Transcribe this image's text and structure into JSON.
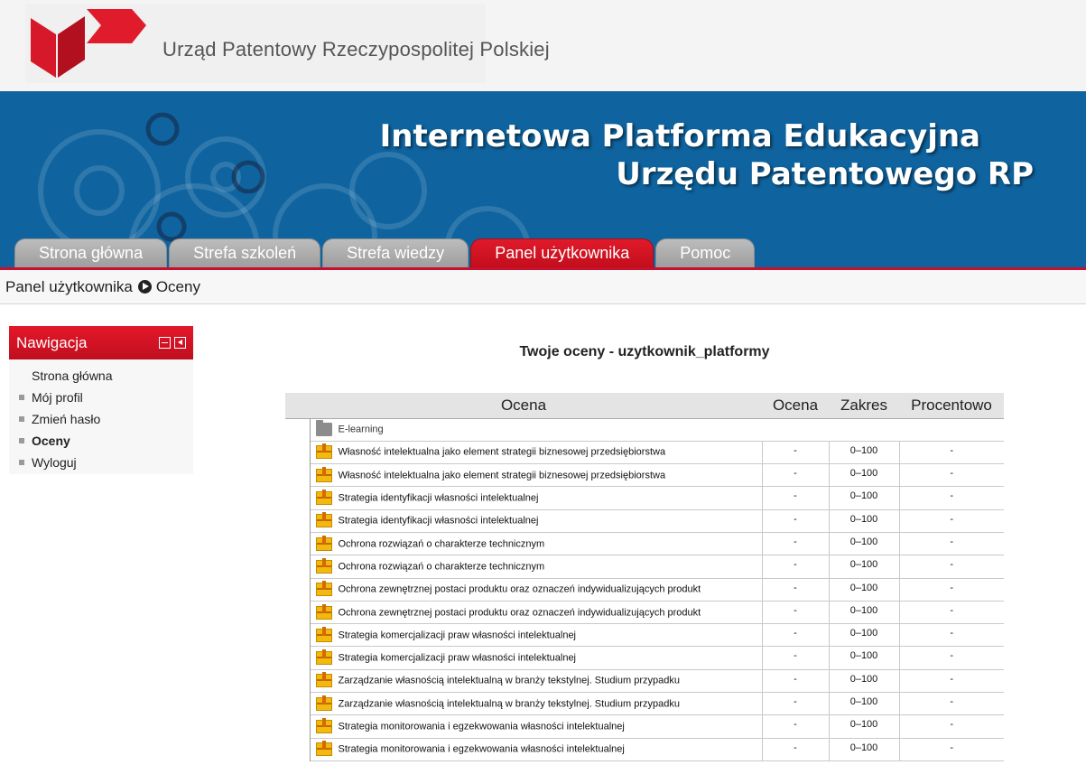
{
  "org": {
    "name": "Urząd Patentowy Rzeczypospolitej Polskiej",
    "brand_color": "#d6182a"
  },
  "banner": {
    "title_line1": "Internetowa Platforma Edukacyjna",
    "title_line2": "Urzędu Patentowego RP",
    "background_color": "#0f64a0"
  },
  "tabs": [
    {
      "label": "Strona główna",
      "active": false
    },
    {
      "label": "Strefa szkoleń",
      "active": false
    },
    {
      "label": "Strefa wiedzy",
      "active": false
    },
    {
      "label": "Panel użytkownika",
      "active": true
    },
    {
      "label": "Pomoc",
      "active": false
    }
  ],
  "breadcrumb": {
    "items": [
      "Panel użytkownika",
      "Oceny"
    ]
  },
  "navigation": {
    "title": "Nawigacja",
    "items": [
      {
        "label": "Strona główna",
        "bullet": false,
        "bold": false
      },
      {
        "label": "Mój profil",
        "bullet": true,
        "bold": false
      },
      {
        "label": "Zmień hasło",
        "bullet": true,
        "bold": false
      },
      {
        "label": "Oceny",
        "bullet": true,
        "bold": true
      },
      {
        "label": "Wyloguj",
        "bullet": true,
        "bold": false
      }
    ]
  },
  "main": {
    "heading": "Twoje oceny - uzytkownik_platformy",
    "table": {
      "columns": [
        "Ocena",
        "Ocena",
        "Zakres",
        "Procentowo"
      ],
      "category": "E-learning",
      "rows": [
        {
          "name": "Własność intelektualna jako element strategii biznesowej przedsiębiorstwa",
          "grade": "-",
          "range": "0–100",
          "percent": "-"
        },
        {
          "name": "Własność intelektualna jako element strategii biznesowej przedsiębiorstwa",
          "grade": "-",
          "range": "0–100",
          "percent": "-"
        },
        {
          "name": "Strategia identyfikacji własności intelektualnej",
          "grade": "-",
          "range": "0–100",
          "percent": "-"
        },
        {
          "name": "Strategia identyfikacji własności intelektualnej",
          "grade": "-",
          "range": "0–100",
          "percent": "-"
        },
        {
          "name": "Ochrona rozwiązań o charakterze technicznym",
          "grade": "-",
          "range": "0–100",
          "percent": "-"
        },
        {
          "name": "Ochrona rozwiązań o charakterze technicznym",
          "grade": "-",
          "range": "0–100",
          "percent": "-"
        },
        {
          "name": "Ochrona zewnętrznej postaci produktu oraz oznaczeń indywidualizujących produkt",
          "grade": "-",
          "range": "0–100",
          "percent": "-"
        },
        {
          "name": "Ochrona zewnętrznej postaci produktu oraz oznaczeń indywidualizujących produkt",
          "grade": "-",
          "range": "0–100",
          "percent": "-"
        },
        {
          "name": "Strategia komercjalizacji praw własności intelektualnej",
          "grade": "-",
          "range": "0–100",
          "percent": "-"
        },
        {
          "name": "Strategia komercjalizacji praw własności intelektualnej",
          "grade": "-",
          "range": "0–100",
          "percent": "-"
        },
        {
          "name": "Zarządzanie własnością intelektualną w branży tekstylnej. Studium przypadku",
          "grade": "-",
          "range": "0–100",
          "percent": "-"
        },
        {
          "name": "Zarządzanie własnością intelektualną w branży tekstylnej. Studium przypadku",
          "grade": "-",
          "range": "0–100",
          "percent": "-"
        },
        {
          "name": "Strategia monitorowania i egzekwowania własności intelektualnej",
          "grade": "-",
          "range": "0–100",
          "percent": "-"
        },
        {
          "name": "Strategia monitorowania i egzekwowania własności intelektualnej",
          "grade": "-",
          "range": "0–100",
          "percent": "-"
        }
      ]
    }
  }
}
